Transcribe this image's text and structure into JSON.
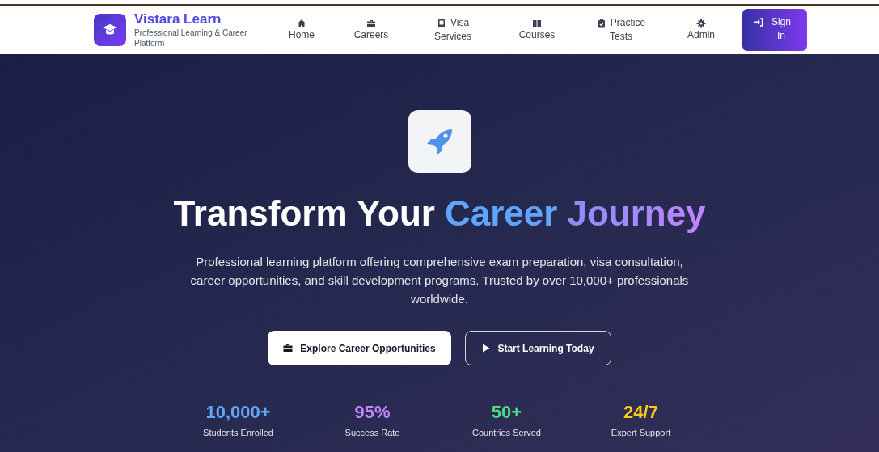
{
  "brand": {
    "name": "Vistara Learn",
    "tagline": "Professional Learning & Career Platform"
  },
  "nav": [
    {
      "kind": "home",
      "label": "Home"
    },
    {
      "kind": "briefcase",
      "label": "Careers"
    },
    {
      "kind": "passport",
      "label": "Visa Services"
    },
    {
      "kind": "book",
      "label": "Courses"
    },
    {
      "kind": "clipboard",
      "label": "Practice Tests"
    },
    {
      "kind": "gear",
      "label": "Admin"
    }
  ],
  "sign_in": "Sign In",
  "hero": {
    "title": [
      {
        "kind": "plain",
        "text": "Transform Your"
      },
      {
        "kind": "blue",
        "text": "Career"
      },
      {
        "kind": "purple",
        "text": "Journey"
      }
    ],
    "description": "Professional learning platform offering comprehensive exam preparation, visa consultation, career opportunities, and skill development programs. Trusted by over 10,000+ professionals worldwide.",
    "buttons": [
      {
        "kind": "primary",
        "label": "Explore Career Opportunities"
      },
      {
        "kind": "outline",
        "label": "Start Learning Today"
      }
    ]
  },
  "stats": [
    {
      "value": "10,000+",
      "label": "Students Enrolled",
      "color": "#60a5fa"
    },
    {
      "value": "95%",
      "label": "Success Rate",
      "color": "#c084fc"
    },
    {
      "value": "50+",
      "label": "Countries Served",
      "color": "#4ade80"
    },
    {
      "value": "24/7",
      "label": "Expert Support",
      "color": "#facc15"
    }
  ]
}
